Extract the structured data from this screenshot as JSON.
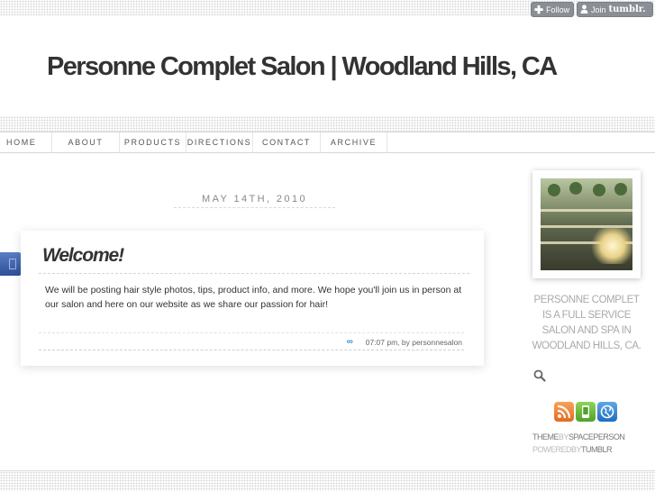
{
  "tumblr_controls": {
    "follow_label": "Follow",
    "join_label": "Join",
    "join_brand": "tumblr."
  },
  "header": {
    "site_title": "Personne Complet Salon | Woodland Hills, CA"
  },
  "nav": {
    "items": [
      {
        "label": "HOME"
      },
      {
        "label": "ABOUT"
      },
      {
        "label": "PRODUCTS"
      },
      {
        "label": "DIRECTIONS"
      },
      {
        "label": "CONTACT"
      },
      {
        "label": "ARCHIVE"
      }
    ]
  },
  "main": {
    "date": "MAY 14TH, 2010",
    "post": {
      "title": "Welcome!",
      "body": "We will be posting hair style photos, tips, product info, and more. We hope you'll join us in person at our salon and here on our website as we share our passion for hair!",
      "permalink_icon": "∞",
      "meta": "07:07 pm, by personnesalon"
    }
  },
  "sidebar": {
    "description": "Personne Complet is a full service salon and spa in Woodland Hills, CA.",
    "social_icons": [
      "rss-icon",
      "mobile-icon",
      "globe-icon"
    ],
    "credits": {
      "theme_prefix": "THEME",
      "theme_by": "BY",
      "theme_author": "SPACEPERSON",
      "powered_prefix": "POWERED",
      "powered_by": "BY",
      "powered_name": "TUMBLR"
    }
  },
  "colors": {
    "text": "#333333",
    "muted": "#aaaaaa",
    "link_accent": "#3a8ed8",
    "tumblr_button": "#8a8f95"
  }
}
